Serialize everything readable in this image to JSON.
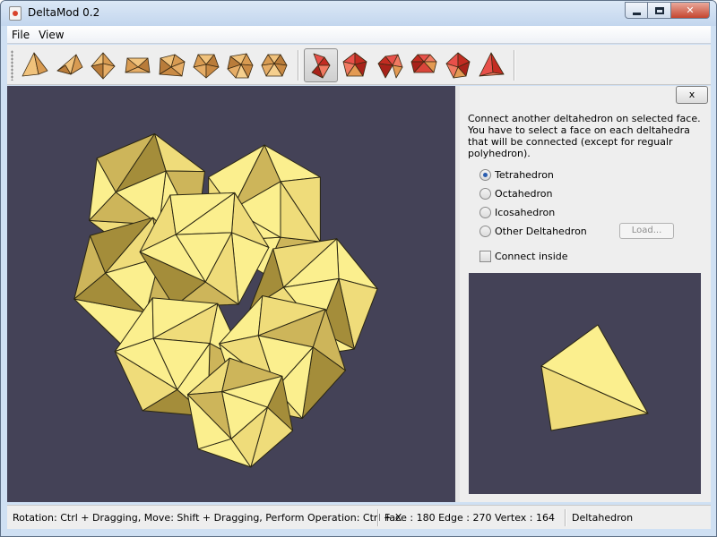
{
  "window": {
    "title": "DeltaMod 0.2"
  },
  "menu": {
    "items": [
      "File",
      "View"
    ]
  },
  "toolbar": {
    "tools": [
      "tetrahedron-icon",
      "triangular-bipyramid-icon",
      "octahedron-icon",
      "pentagonal-bipyramid-icon",
      "snub-disphenoid-icon",
      "triaugmented-prism-icon",
      "gyroelongated-bipyramid-icon",
      "icosahedron-icon",
      "connect-deltahedron-icon",
      "stellate-icon",
      "augment-icon",
      "truncate-icon",
      "dual-icon",
      "face-select-icon"
    ],
    "selected_index": 8
  },
  "panel": {
    "close_label": "x",
    "description": "Connect another deltahedron on selected face. You have to select a face on each deltahedra that will be connected (except for regualr polyhedron).",
    "options": [
      {
        "label": "Tetrahedron",
        "selected": true
      },
      {
        "label": "Octahedron",
        "selected": false
      },
      {
        "label": "Icosahedron",
        "selected": false
      },
      {
        "label": "Other Deltahedron",
        "selected": false
      }
    ],
    "load_label": "Load...",
    "connect_inside_label": "Connect inside",
    "connect_inside_checked": false
  },
  "status": {
    "hint": "Rotation: Ctrl + Dragging, Move: Shift + Dragging, Perform Operation: Ctrl + X",
    "counts": "Face : 180  Edge : 270  Vertex : 164",
    "shape": "Deltahedron"
  },
  "colors": {
    "viewport_bg": "#444257",
    "face_light": "#fbef8e",
    "face_mid": "#efdc7a",
    "face_dark": "#cdb55a",
    "face_shadow": "#a48d3a",
    "icon_tan": "#e1a35b",
    "icon_red": "#d83a2c"
  }
}
